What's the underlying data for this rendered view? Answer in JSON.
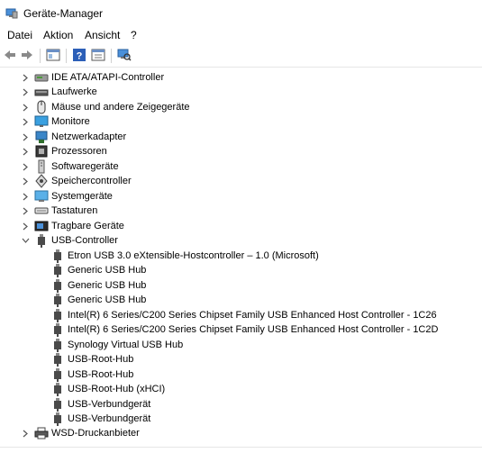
{
  "window": {
    "title": "Geräte-Manager"
  },
  "menu": {
    "file": "Datei",
    "action": "Aktion",
    "view": "Ansicht",
    "help": "?"
  },
  "tree": {
    "ide": "IDE ATA/ATAPI-Controller",
    "drives": "Laufwerke",
    "mice": "Mäuse und andere Zeigegeräte",
    "monitors": "Monitore",
    "netadapters": "Netzwerkadapter",
    "processors": "Prozessoren",
    "software": "Softwaregeräte",
    "storage": "Speichercontroller",
    "system": "Systemgeräte",
    "keyboards": "Tastaturen",
    "portable": "Tragbare Geräte",
    "usb": "USB-Controller",
    "wsd": "WSD-Druckanbieter",
    "usb_children": [
      "Etron USB 3.0 eXtensible-Hostcontroller – 1.0 (Microsoft)",
      "Generic USB Hub",
      "Generic USB Hub",
      "Generic USB Hub",
      "Intel(R) 6 Series/C200 Series Chipset Family USB Enhanced Host Controller - 1C26",
      "Intel(R) 6 Series/C200 Series Chipset Family USB Enhanced Host Controller - 1C2D",
      "Synology Virtual USB Hub",
      "USB-Root-Hub",
      "USB-Root-Hub",
      "USB-Root-Hub (xHCI)",
      "USB-Verbundgerät",
      "USB-Verbundgerät"
    ]
  }
}
